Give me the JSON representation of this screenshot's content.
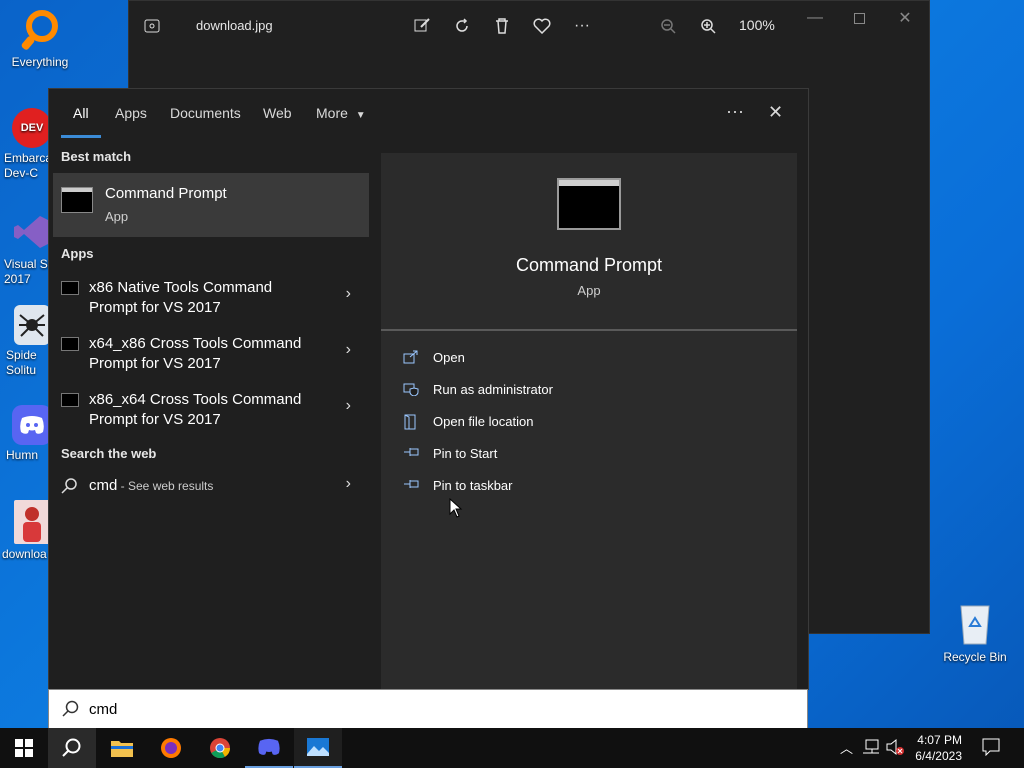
{
  "desktop": {
    "icons": [
      {
        "label": "Everything"
      },
      {
        "label": "Embarca\nDev-C"
      },
      {
        "label": "Visual St\n2017"
      },
      {
        "label": "Spide\nSolitu"
      },
      {
        "label": "Humn"
      },
      {
        "label": "downloa"
      }
    ],
    "recycle_bin": "Recycle Bin"
  },
  "photos_window": {
    "title": "download.jpg",
    "zoom": "100%"
  },
  "search_panel": {
    "tabs": [
      "All",
      "Apps",
      "Documents",
      "Web",
      "More"
    ],
    "sections": {
      "best_match": "Best match",
      "apps": "Apps",
      "search_web": "Search the web"
    },
    "best_match": {
      "title": "Command Prompt",
      "subtitle": "App"
    },
    "apps": [
      {
        "title": "x86 Native Tools Command Prompt for VS 2017"
      },
      {
        "title": "x64_x86 Cross Tools Command Prompt for VS 2017"
      },
      {
        "title": "x86_x64 Cross Tools Command Prompt for VS 2017"
      }
    ],
    "web": {
      "query": "cmd",
      "suffix": " - See web results"
    },
    "detail": {
      "title": "Command Prompt",
      "subtitle": "App",
      "actions": [
        "Open",
        "Run as administrator",
        "Open file location",
        "Pin to Start",
        "Pin to taskbar"
      ]
    },
    "search_input_value": "cmd"
  },
  "taskbar": {
    "time": "4:07 PM",
    "date": "6/4/2023"
  },
  "colors": {
    "accent": "#3b8bd6",
    "panel_bg": "#1f1f1f",
    "selected_bg": "#3a3a3a"
  }
}
